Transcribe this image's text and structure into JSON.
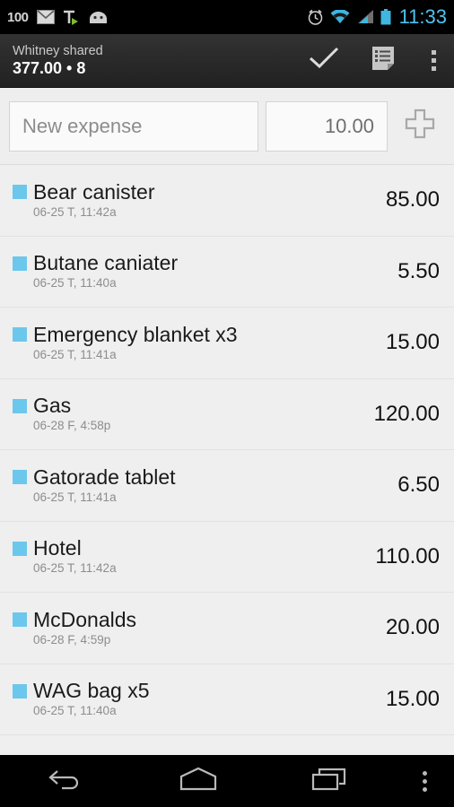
{
  "status_bar": {
    "battery_text": "100",
    "time": "11:33",
    "clock_color": "#4ec3f0",
    "left_icons": [
      "battery-percent-text",
      "gmail-icon",
      "tasks-icon",
      "android-icon"
    ],
    "right_icons": [
      "alarm-icon",
      "wifi-icon",
      "signal-icon",
      "battery-icon"
    ]
  },
  "action_bar": {
    "title": "Whitney shared",
    "subtitle": "377.00 • 8",
    "actions": [
      {
        "name": "confirm-check-button",
        "icon": "check-icon"
      },
      {
        "name": "notes-button",
        "icon": "note-list-icon"
      },
      {
        "name": "overflow-menu-button",
        "icon": "overflow-dots-icon"
      }
    ]
  },
  "input_row": {
    "name_placeholder": "New expense",
    "name_value": "",
    "amount_value": "10.00",
    "amount_placeholder": "",
    "add_icon": "plus-icon"
  },
  "list": {
    "swatch_color": "#6cc7ec",
    "items": [
      {
        "title": "Bear canister",
        "date": "06-25 T, 11:42a",
        "amount": "85.00"
      },
      {
        "title": "Butane caniater",
        "date": "06-25 T, 11:40a",
        "amount": "5.50"
      },
      {
        "title": "Emergency blanket x3",
        "date": "06-25 T, 11:41a",
        "amount": "15.00"
      },
      {
        "title": "Gas",
        "date": "06-28 F, 4:58p",
        "amount": "120.00"
      },
      {
        "title": "Gatorade tablet",
        "date": "06-25 T, 11:41a",
        "amount": "6.50"
      },
      {
        "title": "Hotel",
        "date": "06-25 T, 11:42a",
        "amount": "110.00"
      },
      {
        "title": "McDonalds",
        "date": "06-28 F, 4:59p",
        "amount": "20.00"
      },
      {
        "title": "WAG bag x5",
        "date": "06-25 T, 11:40a",
        "amount": "15.00"
      }
    ]
  },
  "nav_bar": {
    "buttons": [
      {
        "name": "nav-back-button",
        "icon": "back-arrow-icon"
      },
      {
        "name": "nav-home-button",
        "icon": "home-icon"
      },
      {
        "name": "nav-recents-button",
        "icon": "recents-icon"
      },
      {
        "name": "nav-menu-button",
        "icon": "overflow-dots-icon"
      }
    ]
  }
}
